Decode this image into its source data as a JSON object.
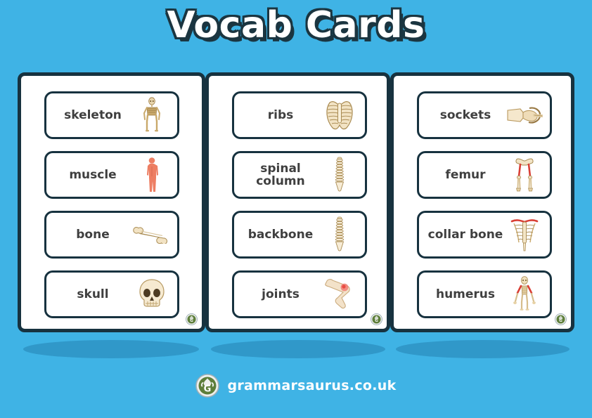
{
  "page": {
    "title": "Vocab Cards",
    "background_color": "#3fb3e5",
    "border_color": "#17323f",
    "text_color": "#3f3f3f",
    "shadow_color": "#2e93c4"
  },
  "panels": [
    {
      "name": "panel-1",
      "cards": [
        {
          "label": "skeleton",
          "icon": "skeleton-icon"
        },
        {
          "label": "muscle",
          "icon": "muscle-body-icon"
        },
        {
          "label": "bone",
          "icon": "bone-icon"
        },
        {
          "label": "skull",
          "icon": "skull-icon"
        }
      ]
    },
    {
      "name": "panel-2",
      "cards": [
        {
          "label": "ribs",
          "icon": "rib-cage-icon"
        },
        {
          "label": "spinal\ncolumn",
          "icon": "spine-icon"
        },
        {
          "label": "backbone",
          "icon": "spine-icon"
        },
        {
          "label": "joints",
          "icon": "knee-joint-icon"
        }
      ]
    },
    {
      "name": "panel-3",
      "cards": [
        {
          "label": "sockets",
          "icon": "ball-socket-joint-icon"
        },
        {
          "label": "femur",
          "icon": "femur-legs-icon"
        },
        {
          "label": "collar bone",
          "icon": "collar-bone-icon"
        },
        {
          "label": "humerus",
          "icon": "humerus-skeleton-icon"
        }
      ]
    }
  ],
  "footer": {
    "text": "grammarsaurus.co.uk",
    "logo": "grammarsaurus-logo-icon",
    "logo_colors": {
      "ring": "#e8eae7",
      "inner": "#5d7e3a",
      "letter": "#ffffff"
    }
  }
}
